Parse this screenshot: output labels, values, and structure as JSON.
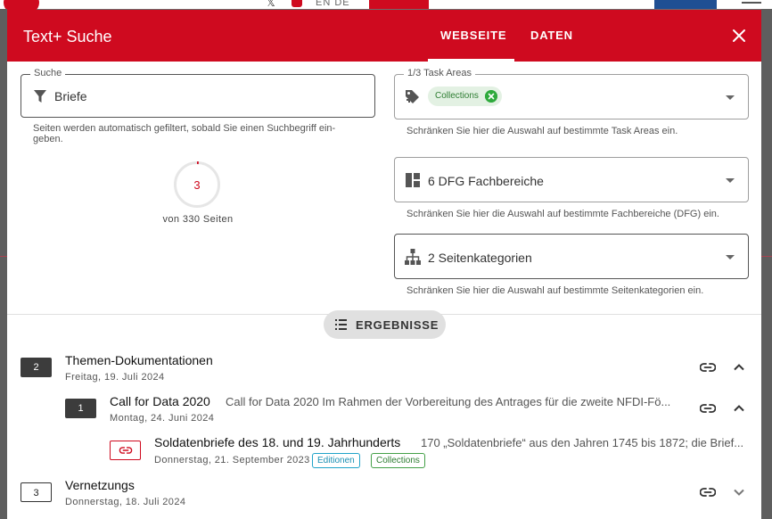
{
  "background": {
    "lang_label": "EN DE",
    "accent_red": "#cf0a1f",
    "login_blue": "#1f4f93"
  },
  "dialog": {
    "title": "Text+ Suche",
    "tabs": [
      {
        "label": "WEBSEITE",
        "active": true
      },
      {
        "label": "DATEN",
        "active": false
      }
    ],
    "close_icon": "close-icon"
  },
  "search": {
    "legend": "Suche",
    "value": "Briefe",
    "icon": "filter-icon",
    "hint": "Seiten werden automatisch gefiltert, sobald Sie einen Suchbegriff ein- geben.",
    "hint_line1": "Seiten werden automatisch gefiltert, sobald Sie einen Suchbegriff ein-",
    "hint_line2": "geben."
  },
  "counter": {
    "count": "3",
    "caption": "von 330 Seiten",
    "fraction": 0.00909
  },
  "filters": {
    "task_areas": {
      "legend": "1/3 Task Areas",
      "icon": "tag-plus-icon",
      "chips": [
        "Collections"
      ],
      "hint": "Schränken Sie hier die Auswahl auf bestimmte Task Areas ein."
    },
    "dfg": {
      "label": "6 DFG Fachbereiche",
      "icon": "dashboard-icon",
      "hint": "Schränken Sie hier die Auswahl auf bestimmte Fachbereiche (DFG) ein."
    },
    "categories": {
      "label": "2 Seitenkategorien",
      "icon": "sitemap-icon",
      "hint": "Schränken Sie hier die Auswahl auf bestimmte Seitenkategorien ein."
    }
  },
  "results_button": {
    "label": "ERGEBNISSE",
    "icon": "list-icon"
  },
  "results": [
    {
      "badge": "2",
      "title": "Themen-Dokumentationen",
      "date": "Freitag, 19. Juli 2024",
      "expanded": true
    },
    {
      "badge": "1",
      "title": "Call for Data 2020",
      "description": "Call for Data 2020 Im Rahmen der Vorbereitung des Antrages für die zweite NFDI-Fö...",
      "date": "Montag, 24. Juni 2024",
      "expanded": true
    },
    {
      "title": "Soldatenbriefe des 18. und 19. Jahrhunderts",
      "description": "170 „Soldatenbriefe“ aus den Jahren 1745 bis 1872; die Brief...",
      "date": "Donnerstag, 21. September 2023",
      "tags": [
        "Editionen",
        "Collections"
      ]
    },
    {
      "badge": "3",
      "title": "Vernetzungs",
      "date": "Donnerstag, 18. Juli 2024",
      "expanded": false
    }
  ]
}
